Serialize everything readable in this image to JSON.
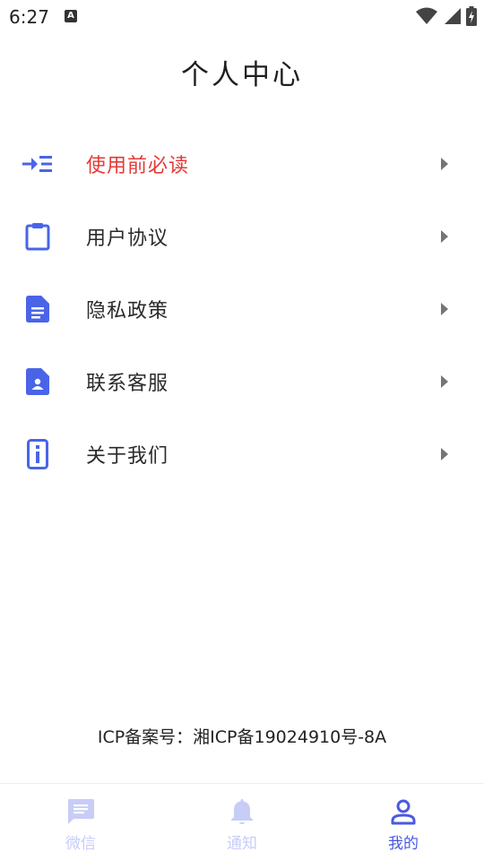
{
  "status_bar": {
    "time": "6:27",
    "notification_icon_letter": "A",
    "icons": [
      "wifi-icon",
      "signal-icon",
      "battery-charging-icon"
    ]
  },
  "page": {
    "title": "个人中心"
  },
  "menu": {
    "items": [
      {
        "label": "使用前必读",
        "icon": "arrow-indent-icon",
        "highlight": true
      },
      {
        "label": "用户协议",
        "icon": "clipboard-icon",
        "highlight": false
      },
      {
        "label": "隐私政策",
        "icon": "document-icon",
        "highlight": false
      },
      {
        "label": "联系客服",
        "icon": "contact-file-icon",
        "highlight": false
      },
      {
        "label": "关于我们",
        "icon": "info-icon",
        "highlight": false
      }
    ]
  },
  "footer": {
    "icp": "ICP备案号：湘ICP备19024910号-8A"
  },
  "bottom_nav": {
    "items": [
      {
        "label": "微信",
        "icon": "chat-icon",
        "active": false
      },
      {
        "label": "通知",
        "icon": "bell-icon",
        "active": false
      },
      {
        "label": "我的",
        "icon": "person-icon",
        "active": true
      }
    ]
  },
  "colors": {
    "accent": "#4a5ae0",
    "icon_blue": "#4a64e8",
    "highlight_red": "#e53935",
    "inactive_nav": "#c7cdf7"
  }
}
